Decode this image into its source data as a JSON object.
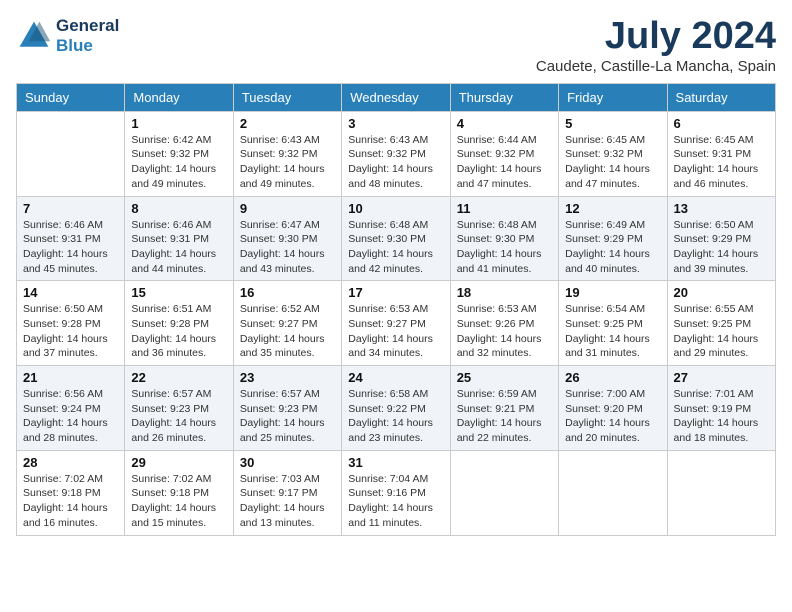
{
  "header": {
    "logo_line1": "General",
    "logo_line2": "Blue",
    "month_year": "July 2024",
    "location": "Caudete, Castille-La Mancha, Spain"
  },
  "weekdays": [
    "Sunday",
    "Monday",
    "Tuesday",
    "Wednesday",
    "Thursday",
    "Friday",
    "Saturday"
  ],
  "weeks": [
    [
      {
        "day": "",
        "sunrise": "",
        "sunset": "",
        "daylight": ""
      },
      {
        "day": "1",
        "sunrise": "Sunrise: 6:42 AM",
        "sunset": "Sunset: 9:32 PM",
        "daylight": "Daylight: 14 hours and 49 minutes."
      },
      {
        "day": "2",
        "sunrise": "Sunrise: 6:43 AM",
        "sunset": "Sunset: 9:32 PM",
        "daylight": "Daylight: 14 hours and 49 minutes."
      },
      {
        "day": "3",
        "sunrise": "Sunrise: 6:43 AM",
        "sunset": "Sunset: 9:32 PM",
        "daylight": "Daylight: 14 hours and 48 minutes."
      },
      {
        "day": "4",
        "sunrise": "Sunrise: 6:44 AM",
        "sunset": "Sunset: 9:32 PM",
        "daylight": "Daylight: 14 hours and 47 minutes."
      },
      {
        "day": "5",
        "sunrise": "Sunrise: 6:45 AM",
        "sunset": "Sunset: 9:32 PM",
        "daylight": "Daylight: 14 hours and 47 minutes."
      },
      {
        "day": "6",
        "sunrise": "Sunrise: 6:45 AM",
        "sunset": "Sunset: 9:31 PM",
        "daylight": "Daylight: 14 hours and 46 minutes."
      }
    ],
    [
      {
        "day": "7",
        "sunrise": "Sunrise: 6:46 AM",
        "sunset": "Sunset: 9:31 PM",
        "daylight": "Daylight: 14 hours and 45 minutes."
      },
      {
        "day": "8",
        "sunrise": "Sunrise: 6:46 AM",
        "sunset": "Sunset: 9:31 PM",
        "daylight": "Daylight: 14 hours and 44 minutes."
      },
      {
        "day": "9",
        "sunrise": "Sunrise: 6:47 AM",
        "sunset": "Sunset: 9:30 PM",
        "daylight": "Daylight: 14 hours and 43 minutes."
      },
      {
        "day": "10",
        "sunrise": "Sunrise: 6:48 AM",
        "sunset": "Sunset: 9:30 PM",
        "daylight": "Daylight: 14 hours and 42 minutes."
      },
      {
        "day": "11",
        "sunrise": "Sunrise: 6:48 AM",
        "sunset": "Sunset: 9:30 PM",
        "daylight": "Daylight: 14 hours and 41 minutes."
      },
      {
        "day": "12",
        "sunrise": "Sunrise: 6:49 AM",
        "sunset": "Sunset: 9:29 PM",
        "daylight": "Daylight: 14 hours and 40 minutes."
      },
      {
        "day": "13",
        "sunrise": "Sunrise: 6:50 AM",
        "sunset": "Sunset: 9:29 PM",
        "daylight": "Daylight: 14 hours and 39 minutes."
      }
    ],
    [
      {
        "day": "14",
        "sunrise": "Sunrise: 6:50 AM",
        "sunset": "Sunset: 9:28 PM",
        "daylight": "Daylight: 14 hours and 37 minutes."
      },
      {
        "day": "15",
        "sunrise": "Sunrise: 6:51 AM",
        "sunset": "Sunset: 9:28 PM",
        "daylight": "Daylight: 14 hours and 36 minutes."
      },
      {
        "day": "16",
        "sunrise": "Sunrise: 6:52 AM",
        "sunset": "Sunset: 9:27 PM",
        "daylight": "Daylight: 14 hours and 35 minutes."
      },
      {
        "day": "17",
        "sunrise": "Sunrise: 6:53 AM",
        "sunset": "Sunset: 9:27 PM",
        "daylight": "Daylight: 14 hours and 34 minutes."
      },
      {
        "day": "18",
        "sunrise": "Sunrise: 6:53 AM",
        "sunset": "Sunset: 9:26 PM",
        "daylight": "Daylight: 14 hours and 32 minutes."
      },
      {
        "day": "19",
        "sunrise": "Sunrise: 6:54 AM",
        "sunset": "Sunset: 9:25 PM",
        "daylight": "Daylight: 14 hours and 31 minutes."
      },
      {
        "day": "20",
        "sunrise": "Sunrise: 6:55 AM",
        "sunset": "Sunset: 9:25 PM",
        "daylight": "Daylight: 14 hours and 29 minutes."
      }
    ],
    [
      {
        "day": "21",
        "sunrise": "Sunrise: 6:56 AM",
        "sunset": "Sunset: 9:24 PM",
        "daylight": "Daylight: 14 hours and 28 minutes."
      },
      {
        "day": "22",
        "sunrise": "Sunrise: 6:57 AM",
        "sunset": "Sunset: 9:23 PM",
        "daylight": "Daylight: 14 hours and 26 minutes."
      },
      {
        "day": "23",
        "sunrise": "Sunrise: 6:57 AM",
        "sunset": "Sunset: 9:23 PM",
        "daylight": "Daylight: 14 hours and 25 minutes."
      },
      {
        "day": "24",
        "sunrise": "Sunrise: 6:58 AM",
        "sunset": "Sunset: 9:22 PM",
        "daylight": "Daylight: 14 hours and 23 minutes."
      },
      {
        "day": "25",
        "sunrise": "Sunrise: 6:59 AM",
        "sunset": "Sunset: 9:21 PM",
        "daylight": "Daylight: 14 hours and 22 minutes."
      },
      {
        "day": "26",
        "sunrise": "Sunrise: 7:00 AM",
        "sunset": "Sunset: 9:20 PM",
        "daylight": "Daylight: 14 hours and 20 minutes."
      },
      {
        "day": "27",
        "sunrise": "Sunrise: 7:01 AM",
        "sunset": "Sunset: 9:19 PM",
        "daylight": "Daylight: 14 hours and 18 minutes."
      }
    ],
    [
      {
        "day": "28",
        "sunrise": "Sunrise: 7:02 AM",
        "sunset": "Sunset: 9:18 PM",
        "daylight": "Daylight: 14 hours and 16 minutes."
      },
      {
        "day": "29",
        "sunrise": "Sunrise: 7:02 AM",
        "sunset": "Sunset: 9:18 PM",
        "daylight": "Daylight: 14 hours and 15 minutes."
      },
      {
        "day": "30",
        "sunrise": "Sunrise: 7:03 AM",
        "sunset": "Sunset: 9:17 PM",
        "daylight": "Daylight: 14 hours and 13 minutes."
      },
      {
        "day": "31",
        "sunrise": "Sunrise: 7:04 AM",
        "sunset": "Sunset: 9:16 PM",
        "daylight": "Daylight: 14 hours and 11 minutes."
      },
      {
        "day": "",
        "sunrise": "",
        "sunset": "",
        "daylight": ""
      },
      {
        "day": "",
        "sunrise": "",
        "sunset": "",
        "daylight": ""
      },
      {
        "day": "",
        "sunrise": "",
        "sunset": "",
        "daylight": ""
      }
    ]
  ]
}
